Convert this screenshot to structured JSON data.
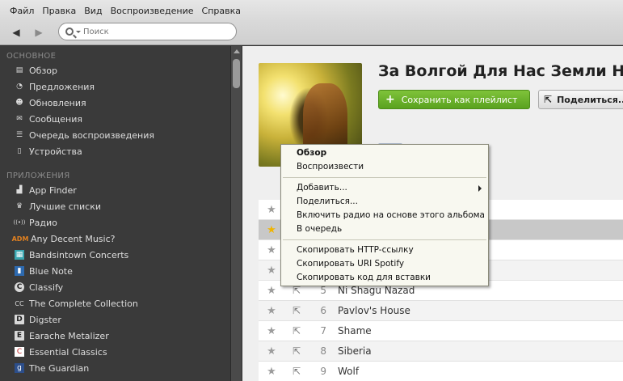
{
  "menu": [
    "Файл",
    "Правка",
    "Вид",
    "Воспроизведение",
    "Справка"
  ],
  "toolbar": {
    "search_placeholder": "Поиск"
  },
  "sidebar": {
    "main_header": "ОСНОВНОЕ",
    "main_items": [
      {
        "label": "Обзор",
        "icon": "overview-icon"
      },
      {
        "label": "Предложения",
        "icon": "suggestions-icon"
      },
      {
        "label": "Обновления",
        "icon": "updates-icon"
      },
      {
        "label": "Сообщения",
        "icon": "messages-icon"
      },
      {
        "label": "Очередь воспроизведения",
        "icon": "queue-icon"
      },
      {
        "label": "Устройства",
        "icon": "devices-icon"
      }
    ],
    "apps_header": "ПРИЛОЖЕНИЯ",
    "apps": [
      {
        "label": "App Finder",
        "icon": "app-finder-icon",
        "glyph": "▟"
      },
      {
        "label": "Лучшие списки",
        "icon": "top-lists-icon",
        "glyph": "♛"
      },
      {
        "label": "Радио",
        "icon": "radio-icon",
        "glyph": "((•))"
      },
      {
        "label": "Any Decent Music?",
        "icon": "adm-logo-icon",
        "glyph": "ADM"
      },
      {
        "label": "Bandsintown Concerts",
        "icon": "bandsintown-icon",
        "glyph": "▦"
      },
      {
        "label": "Blue Note",
        "icon": "blue-note-icon",
        "glyph": "▮"
      },
      {
        "label": "Classify",
        "icon": "classify-icon",
        "glyph": "C"
      },
      {
        "label": "The Complete Collection",
        "icon": "complete-collection-icon",
        "glyph": "CC"
      },
      {
        "label": "Digster",
        "icon": "digster-icon",
        "glyph": "D"
      },
      {
        "label": "Earache Metalizer",
        "icon": "earache-icon",
        "glyph": "E"
      },
      {
        "label": "Essential Classics",
        "icon": "essential-classics-icon",
        "glyph": "C"
      },
      {
        "label": "The Guardian",
        "icon": "guardian-icon",
        "glyph": "g"
      }
    ]
  },
  "album": {
    "title": "За Волгой Для Нас Земли Нет",
    "save_label": "Сохранить как плейлист",
    "share_label": "Поделиться..."
  },
  "tracks": [
    {
      "num": "",
      "name": "",
      "starred": false
    },
    {
      "num": "",
      "name": "",
      "starred": true
    },
    {
      "num": "",
      "name": "",
      "starred": false
    },
    {
      "num": "",
      "name": "",
      "starred": false
    },
    {
      "num": "5",
      "name": "Ni Shagu Nazad",
      "starred": false
    },
    {
      "num": "6",
      "name": "Pavlov's House",
      "starred": false
    },
    {
      "num": "7",
      "name": "Shame",
      "starred": false
    },
    {
      "num": "8",
      "name": "Siberia",
      "starred": false
    },
    {
      "num": "9",
      "name": "Wolf",
      "starred": false
    }
  ],
  "context_menu": {
    "group1": [
      "Обзор",
      "Воспроизвести"
    ],
    "group2": [
      "Добавить...",
      "Поделиться...",
      "Включить радио на основе этого альбома",
      "В очередь"
    ],
    "group3": [
      "Скопировать HTTP-ссылку",
      "Скопировать URI Spotify",
      "Скопировать код для вставки"
    ]
  },
  "colors": {
    "accent_green": "#6ab42a",
    "sidebar_bg": "#3a3a3a",
    "star_active": "#f0b400"
  }
}
